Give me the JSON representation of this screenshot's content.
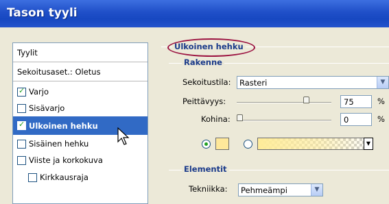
{
  "window": {
    "title": "Tason tyyli"
  },
  "sidebar": {
    "header": "Tyylit",
    "blending": "Sekoitusaset.: Oletus",
    "items": [
      {
        "label": "Varjo",
        "checked": true
      },
      {
        "label": "Sisävarjo",
        "checked": false
      },
      {
        "label": "Ulkoinen hehku",
        "checked": true,
        "selected": true
      },
      {
        "label": "Sisäinen hehku",
        "checked": false
      },
      {
        "label": "Viiste ja korkokuva",
        "checked": false
      },
      {
        "label": "Kirkkausraja",
        "checked": false
      }
    ]
  },
  "panel": {
    "section_title": "Ulkoinen hehku",
    "structure": {
      "title": "Rakenne",
      "blend_mode_label": "Sekoitustila:",
      "blend_mode_value": "Rasteri",
      "opacity_label": "Peittävyys:",
      "opacity_value": "75",
      "opacity_unit": "%",
      "opacity_level": 0.75,
      "noise_label": "Kohina:",
      "noise_value": "0",
      "noise_unit": "%",
      "noise_level": 0.0,
      "glow_color": "#ffe89a"
    },
    "elements": {
      "title": "Elementit",
      "technique_label": "Tekniikka:",
      "technique_value": "Pehmeämpi"
    }
  },
  "colors": {
    "titlebar": "#1f4fc8",
    "selection": "#316ac5",
    "highlight_ellipse": "#9b1240",
    "group_title": "#1a3a8a"
  },
  "icons": [
    "checkbox-check-icon",
    "combo-arrow-icon",
    "slider-thumb-icon",
    "radio-icon",
    "mouse-pointer-icon"
  ]
}
